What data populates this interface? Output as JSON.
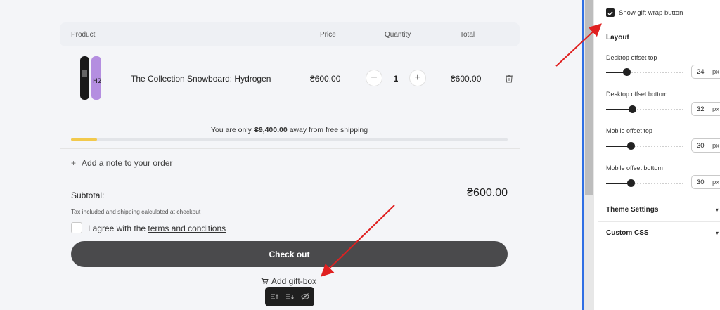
{
  "cart": {
    "headers": {
      "product": "Product",
      "price": "Price",
      "quantity": "Quantity",
      "total": "Total"
    },
    "item": {
      "title": "The Collection Snowboard: Hydrogen",
      "price": "₴600.00",
      "quantity": "1",
      "total": "₴600.00"
    },
    "shipping": {
      "prefix": "You are only ",
      "amount": "₴9,400.00",
      "suffix": " away from free shipping",
      "progress_percent": 6
    },
    "note_label": "Add a note to your order",
    "subtotal_label": "Subtotal:",
    "subtotal_value": "₴600.00",
    "tax_note": "Tax included and shipping calculated at checkout",
    "agree_prefix": "I agree with the ",
    "agree_link": "terms and conditions",
    "checkout_label": "Check out",
    "gift_label": "Add gift-box"
  },
  "panel": {
    "show_gift_wrap_label": "Show gift wrap button",
    "show_gift_wrap_checked": true,
    "layout_heading": "Layout",
    "settings": [
      {
        "label": "Desktop offset top",
        "value": "24",
        "unit": "px"
      },
      {
        "label": "Desktop offset bottom",
        "value": "32",
        "unit": "px"
      },
      {
        "label": "Mobile offset top",
        "value": "30",
        "unit": "px"
      },
      {
        "label": "Mobile offset bottom",
        "value": "30",
        "unit": "px"
      }
    ],
    "theme_settings": "Theme Settings",
    "custom_css": "Custom CSS"
  },
  "colors": {
    "checkout_bg": "#4a4a4c",
    "progress": "#f2c94c",
    "annotation_arrow": "#e02020",
    "editor_accent": "#2f6fe4"
  }
}
